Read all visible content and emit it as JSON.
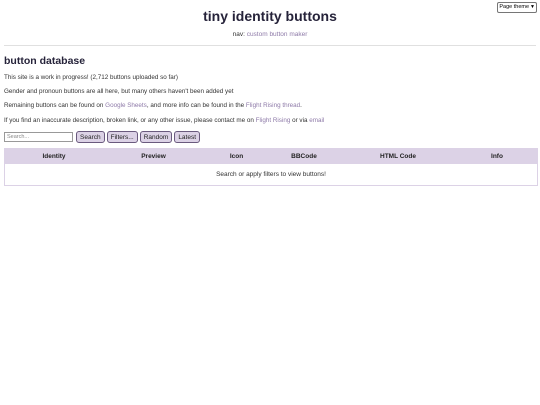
{
  "theme": {
    "selected": "Page theme",
    "icon": "chevron-down-icon"
  },
  "header": {
    "title": "tiny identity buttons",
    "nav_prefix": "nav: ",
    "nav_link": "custom button maker"
  },
  "main": {
    "title": "button database",
    "p1": "This site is a work in progress! (2,712 buttons uploaded so far)",
    "p2": "Gender and pronoun buttons are all here, but many others haven't been added yet",
    "p3": {
      "before": "Remaining buttons can be found on ",
      "link1": "Google Sheets",
      "middle": ", and more info can be found in the ",
      "link2": "Flight Rising thread",
      "after": "."
    },
    "p4": {
      "before": "If you find an inaccurate description, broken link, or any other issue, please contact me on ",
      "link1": "Flight Rising",
      "middle": " or via ",
      "link2": "email"
    }
  },
  "controls": {
    "search_placeholder": "Search...",
    "search_label": "Search",
    "filters_label": "Filters...",
    "random_label": "Random",
    "latest_label": "Latest"
  },
  "table": {
    "columns": [
      "Identity",
      "Preview",
      "Icon",
      "BBCode",
      "HTML Code",
      "Info"
    ],
    "empty_message": "Search or apply filters to view buttons!"
  },
  "colors": {
    "accent": "#dcd2e6",
    "link": "#8e7aa8",
    "title": "#26233a"
  }
}
